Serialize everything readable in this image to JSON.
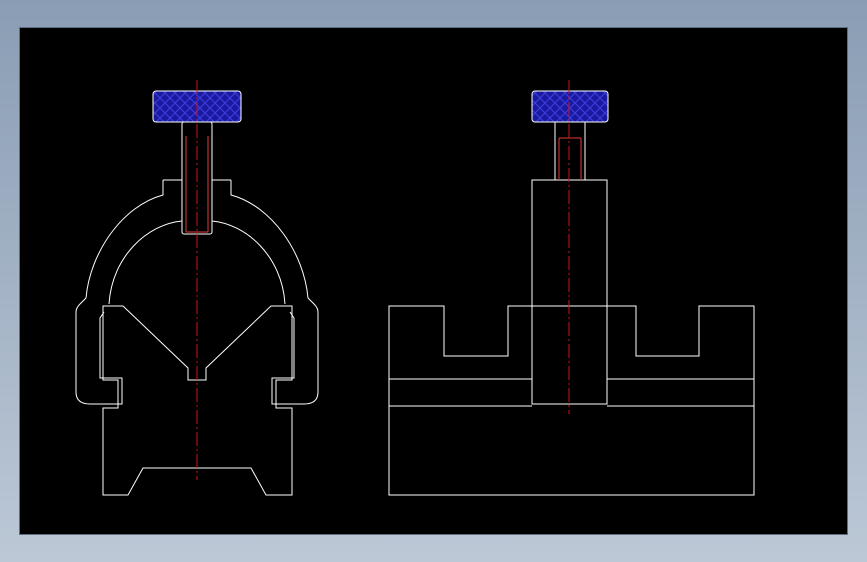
{
  "colors": {
    "window_gradient_top": "#8a9db4",
    "window_gradient_bottom": "#bcc8d6",
    "canvas_background": "#000000",
    "outline": "#ffffff",
    "centerline": "#d21414",
    "thread": "#e23a3a",
    "knurl_fill": "#1a1aa0",
    "knurl_hatch": "#3f3fe0"
  },
  "drawing": {
    "views": [
      {
        "id": "front",
        "description_name": "front-view-v-block-clamp"
      },
      {
        "id": "side",
        "description_name": "side-view-v-block-clamp"
      }
    ],
    "knurl_pattern": "cross-hatch"
  }
}
